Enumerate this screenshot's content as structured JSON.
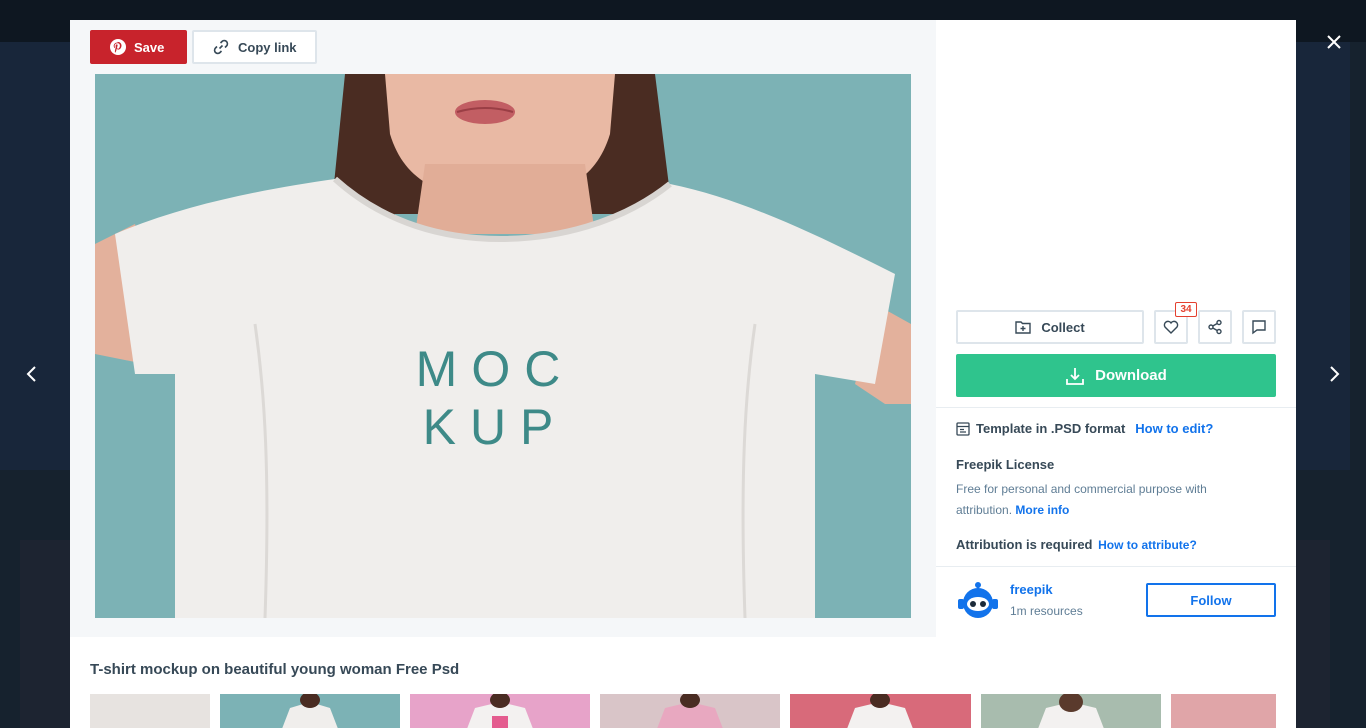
{
  "toolbar": {
    "save_label": "Save",
    "copy_link_label": "Copy link"
  },
  "image": {
    "shirt_text_line1": "MOC",
    "shirt_text_line2": "KUP"
  },
  "actions": {
    "collect_label": "Collect",
    "like_count": "34",
    "download_label": "Download"
  },
  "format": {
    "text": "Template in .PSD format",
    "link": "How to edit?"
  },
  "license": {
    "title": "Freepik License",
    "text": "Free for personal and commercial purpose with attribution.",
    "more_info": "More info",
    "attribution_text": "Attribution is required",
    "attribution_link": "How to attribute?"
  },
  "author": {
    "name": "freepik",
    "resources": "1m resources",
    "follow_label": "Follow"
  },
  "resource_title": "T-shirt mockup on beautiful young woman Free Psd",
  "colors": {
    "save_red": "#c8232c",
    "download_green": "#2fc48d",
    "link_blue": "#1273eb",
    "like_badge_red": "#e4402f",
    "photo_background_teal": "#7cb2b5"
  },
  "icons": {
    "save": "pinterest-icon",
    "copy_link": "link-icon",
    "collect": "folder-plus-icon",
    "like": "heart-icon",
    "share": "share-icon",
    "comment": "comment-icon",
    "download": "download-icon",
    "format": "template-icon",
    "prev": "chevron-left-icon",
    "next": "chevron-right-icon",
    "close": "close-icon"
  }
}
